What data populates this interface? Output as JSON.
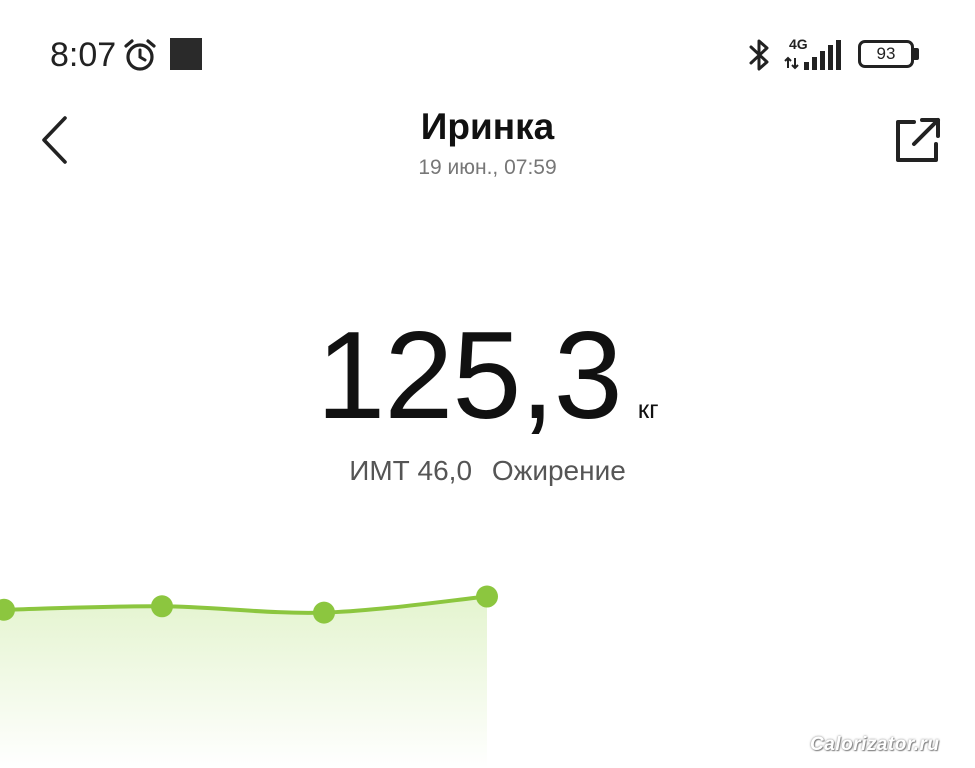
{
  "status_bar": {
    "time": "8:07",
    "network": "4G",
    "battery": "93",
    "icons": [
      "alarm-icon",
      "notification-square-icon",
      "bluetooth-icon",
      "signal-icon",
      "battery-icon"
    ]
  },
  "header": {
    "title": "Иринка",
    "subtitle": "19 июн., 07:59",
    "back_icon": "chevron-left-icon",
    "share_icon": "share-external-icon"
  },
  "measurement": {
    "weight": "125,3",
    "unit": "кг",
    "bmi_label": "ИМТ 46,0",
    "bmi_category": "Ожирение"
  },
  "chart_data": {
    "type": "area",
    "values": [
      123.0,
      123.6,
      122.5,
      125.3
    ],
    "line_color": "#8cc63f",
    "fill_color": "#eef8e2",
    "point_color": "#8cc63f",
    "grid": false
  },
  "watermark": "Calorizator.ru",
  "colors": {
    "accent": "#8cc63f",
    "text_primary": "#111111",
    "text_secondary": "#777777",
    "background": "#ffffff"
  }
}
